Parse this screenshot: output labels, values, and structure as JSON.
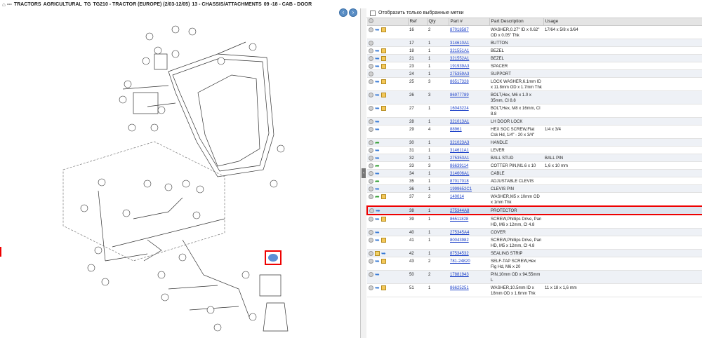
{
  "breadcrumb": [
    "---",
    "TRACTORS",
    "AGRICULTURAL",
    "TG",
    "TG210 - TRACTOR (EUROPE) (2/03-12/05)",
    "13 - CHASSIS/ATTACHMENTS",
    "09 -18 - CAB - DOOR"
  ],
  "filter_label": "Отобразить только выбранные метки",
  "columns": [
    "Ref",
    "Qty",
    "Part #",
    "Part Description",
    "Usage"
  ],
  "rows": [
    {
      "ref": "16",
      "qty": "2",
      "part": "87018587",
      "desc": "WASHER,0.27\" ID x 0.62\" OD x 0.05\" Thk",
      "usage": "17/64 x 5/8 x 3/64",
      "icons": [
        "circ",
        "arrow",
        "box"
      ]
    },
    {
      "ref": "17",
      "qty": "1",
      "part": "314610A1",
      "desc": "BUTTON",
      "usage": "",
      "icons": [
        "circ"
      ]
    },
    {
      "ref": "18",
      "qty": "1",
      "part": "321551A1",
      "desc": "BEZEL",
      "usage": "",
      "icons": [
        "circ",
        "arrow",
        "box"
      ]
    },
    {
      "ref": "21",
      "qty": "1",
      "part": "321552A1",
      "desc": "BEZEL",
      "usage": "",
      "icons": [
        "circ",
        "arrow",
        "box"
      ]
    },
    {
      "ref": "23",
      "qty": "1",
      "part": "191939A3",
      "desc": "SPACER",
      "usage": "",
      "icons": [
        "circ",
        "arrow",
        "box"
      ]
    },
    {
      "ref": "24",
      "qty": "1",
      "part": "275359A3",
      "desc": "SUPPORT",
      "usage": "",
      "icons": [
        "circ"
      ]
    },
    {
      "ref": "25",
      "qty": "3",
      "part": "86517328",
      "desc": "LOCK WASHER,6.1mm ID x 11.8mm OD x 1.7mm Thk",
      "usage": "",
      "icons": [
        "circ",
        "arrow",
        "box"
      ]
    },
    {
      "ref": "26",
      "qty": "3",
      "part": "86977789",
      "desc": "BOLT,Hex, M6 x 1.0 x 35mm, Cl 8.8",
      "usage": "",
      "icons": [
        "circ",
        "arrow",
        "box"
      ]
    },
    {
      "ref": "27",
      "qty": "1",
      "part": "16043224",
      "desc": "BOLT,Hex, M8 x 16mm, Cl 8.8",
      "usage": "",
      "icons": [
        "circ",
        "arrow",
        "box"
      ]
    },
    {
      "ref": "28",
      "qty": "1",
      "part": "321013A1",
      "desc": "LH DOOR LOCK",
      "usage": "",
      "icons": [
        "circ",
        "arrow"
      ]
    },
    {
      "ref": "29",
      "qty": "4",
      "part": "88961",
      "desc": "HEX SOC SCREW,Flat Csk Hd, 1/4\" - 20 x 3/4\"",
      "usage": "1/4 x 3/4",
      "icons": [
        "circ",
        "arrow"
      ]
    },
    {
      "ref": "30",
      "qty": "1",
      "part": "321023A3",
      "desc": "HANDLE",
      "usage": "",
      "icons": [
        "circ",
        "green"
      ]
    },
    {
      "ref": "31",
      "qty": "1",
      "part": "314611A1",
      "desc": "LEVER",
      "usage": "",
      "icons": [
        "circ",
        "arrow"
      ]
    },
    {
      "ref": "32",
      "qty": "1",
      "part": "275353A1",
      "desc": "BALL STUD",
      "usage": "BALL PIN",
      "icons": [
        "circ",
        "arrow"
      ]
    },
    {
      "ref": "33",
      "qty": "3",
      "part": "86639114",
      "desc": "COTTER PIN,M1.6 x 10",
      "usage": "1,6 x 10 mm",
      "icons": [
        "circ",
        "green"
      ]
    },
    {
      "ref": "34",
      "qty": "1",
      "part": "314606A1",
      "desc": "CABLE",
      "usage": "",
      "icons": [
        "circ",
        "arrow"
      ]
    },
    {
      "ref": "35",
      "qty": "1",
      "part": "87017018",
      "desc": "ADJUSTABLE CLEVIS",
      "usage": "",
      "icons": [
        "circ",
        "green"
      ]
    },
    {
      "ref": "36",
      "qty": "1",
      "part": "1999652C1",
      "desc": "CLEVIS PIN",
      "usage": "",
      "icons": [
        "circ",
        "arrow"
      ]
    },
    {
      "ref": "37",
      "qty": "2",
      "part": "140014",
      "desc": "WASHER,M5 x 10mm OD x 1mm Thk",
      "usage": "",
      "icons": [
        "circ",
        "green",
        "box"
      ]
    },
    {
      "ref": "38",
      "qty": "1",
      "part": "275344A8",
      "desc": "PROTECTOR",
      "usage": "",
      "icons": [
        "circ",
        "arrow"
      ],
      "selected": true
    },
    {
      "ref": "39",
      "qty": "1",
      "part": "86511828",
      "desc": "SCREW,Phillips Drive, Pan HD, M6 x 12mm, Cl 4.8",
      "usage": "",
      "icons": [
        "circ",
        "arrow",
        "box"
      ]
    },
    {
      "ref": "40",
      "qty": "1",
      "part": "275345A4",
      "desc": "COVER",
      "usage": "",
      "icons": [
        "circ",
        "arrow"
      ]
    },
    {
      "ref": "41",
      "qty": "1",
      "part": "80043982",
      "desc": "SCREW,Phillips Drive, Pan HD, M5 x 12mm, Cl 4.8",
      "usage": "",
      "icons": [
        "circ",
        "arrow",
        "box"
      ]
    },
    {
      "ref": "42",
      "qty": "1",
      "part": "87534532",
      "desc": "SEALING STRIP",
      "usage": "",
      "icons": [
        "circ",
        "fold",
        "arrow"
      ]
    },
    {
      "ref": "43",
      "qty": "2",
      "part": "781-24820",
      "desc": "SELF-TAP SCREW,Hex Flg Hd, M6 x 20",
      "usage": "",
      "icons": [
        "circ",
        "arrow",
        "box"
      ]
    },
    {
      "ref": "50",
      "qty": "2",
      "part": "17881943",
      "desc": "PIN,10mm OD x 94.55mm L",
      "usage": "",
      "icons": [
        "circ",
        "arrow"
      ]
    },
    {
      "ref": "51",
      "qty": "1",
      "part": "86625251",
      "desc": "WASHER,10.5mm ID x 18mm OD x 1.6mm Thk",
      "usage": "11 x 18 x 1,6 mm",
      "icons": [
        "circ",
        "arrow",
        "box"
      ]
    }
  ]
}
